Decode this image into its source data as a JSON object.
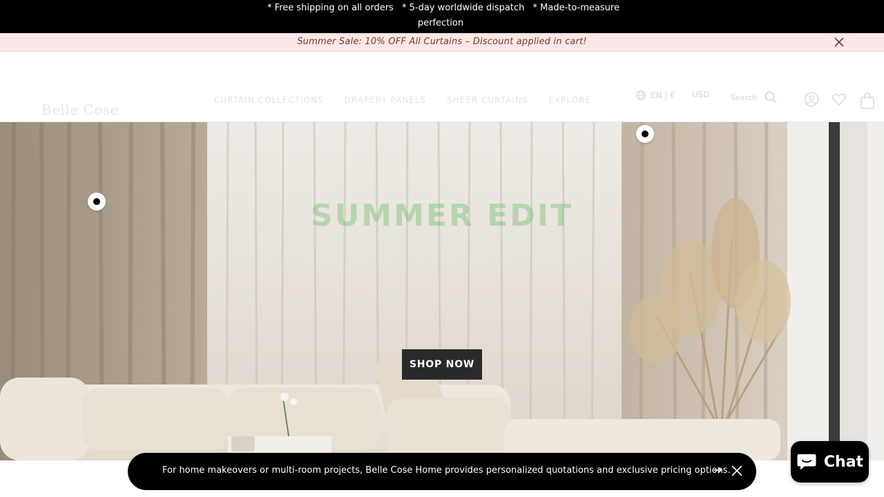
{
  "announcement": {
    "items": [
      "* Free shipping on all orders",
      "* 5-day worldwide dispatch",
      "* Made-to-measure perfection"
    ]
  },
  "sale_bar": {
    "text": "Summer Sale: 10% OFF All Curtains – Discount applied in cart!",
    "close_icon": "close-icon"
  },
  "header": {
    "logo": "Belle Cose",
    "nav": [
      "CURTAIN COLLECTIONS",
      "DRAPERY PANELS",
      "SHEER CURTAINS",
      "EXPLORE"
    ],
    "locale": "EN | €",
    "currency": "USD",
    "search_label": "Search",
    "icons": [
      "globe-icon",
      "search-icon",
      "account-icon",
      "wishlist-icon",
      "cart-icon"
    ]
  },
  "hero": {
    "title": "SUMMER EDIT",
    "cta": "SHOP NOW"
  },
  "info_bar": {
    "text": "For home makeovers or multi-room projects, Belle Cose Home provides personalized quotations and exclusive pricing options."
  },
  "chat": {
    "label": "Chat"
  },
  "colors": {
    "announcement_bg": "#000000",
    "sale_bg": "#fbe7e7",
    "sale_text": "#7a3a2e",
    "cta_bg": "#2a2a2a"
  }
}
